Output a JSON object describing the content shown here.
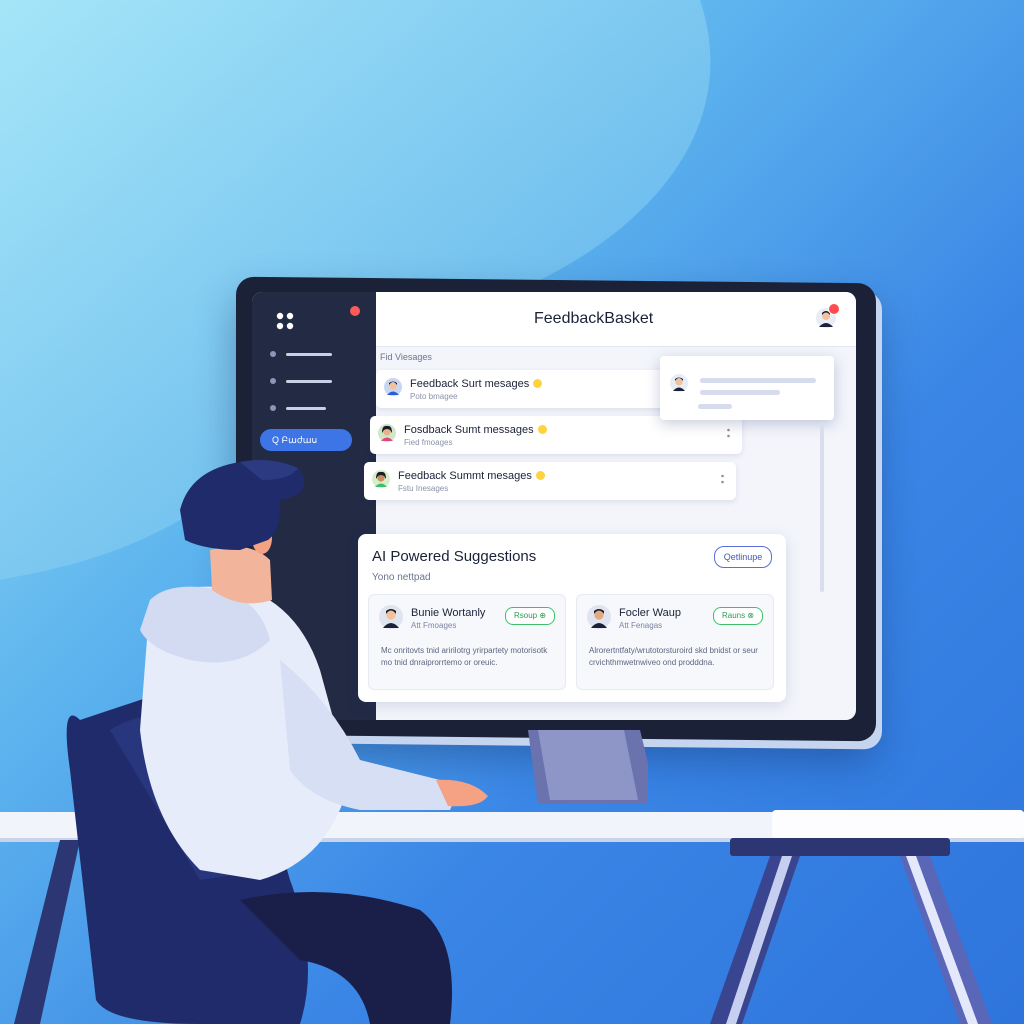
{
  "app": {
    "title": "FeedbackBasket"
  },
  "sidebar": {
    "search_label": "Q Բաժաս",
    "nav_items": [
      "",
      "",
      ""
    ]
  },
  "messages": {
    "section_label": "Fid Viesages",
    "items": [
      {
        "title": "Feedback Surt mesages",
        "subtitle": "Poto bmagee"
      },
      {
        "title": "Fosdback Sumt messages",
        "subtitle": "Fied fmoages"
      },
      {
        "title": "Feedback Summt mesages",
        "subtitle": "Fstu Inesages"
      }
    ]
  },
  "ai_panel": {
    "title": "AI Powered Suggestions",
    "subtitle": "Yono nettpad",
    "action_label": "Qetlinupe",
    "cards": [
      {
        "name": "Bunie Wortanly",
        "meta": "Att Fmoages",
        "pill": "Rsoup ⊕",
        "body": "Mc onritovts tnid aririlotrg yrirpartety motorisotk mo tnid dnraiprorrtemo or oreuic."
      },
      {
        "name": "Focler Waup",
        "meta": "Att Fenagas",
        "pill": "Rauns ⊗",
        "body": "Alrorertntfaty/wrutotorsturoird skd bnidst or seur crvichthmwetnwiveo ond prodddna."
      }
    ]
  },
  "colors": {
    "accent": "#3d74e6",
    "sidebar": "#222a44",
    "success": "#3fbf6a",
    "alert": "#ff4d4f"
  }
}
